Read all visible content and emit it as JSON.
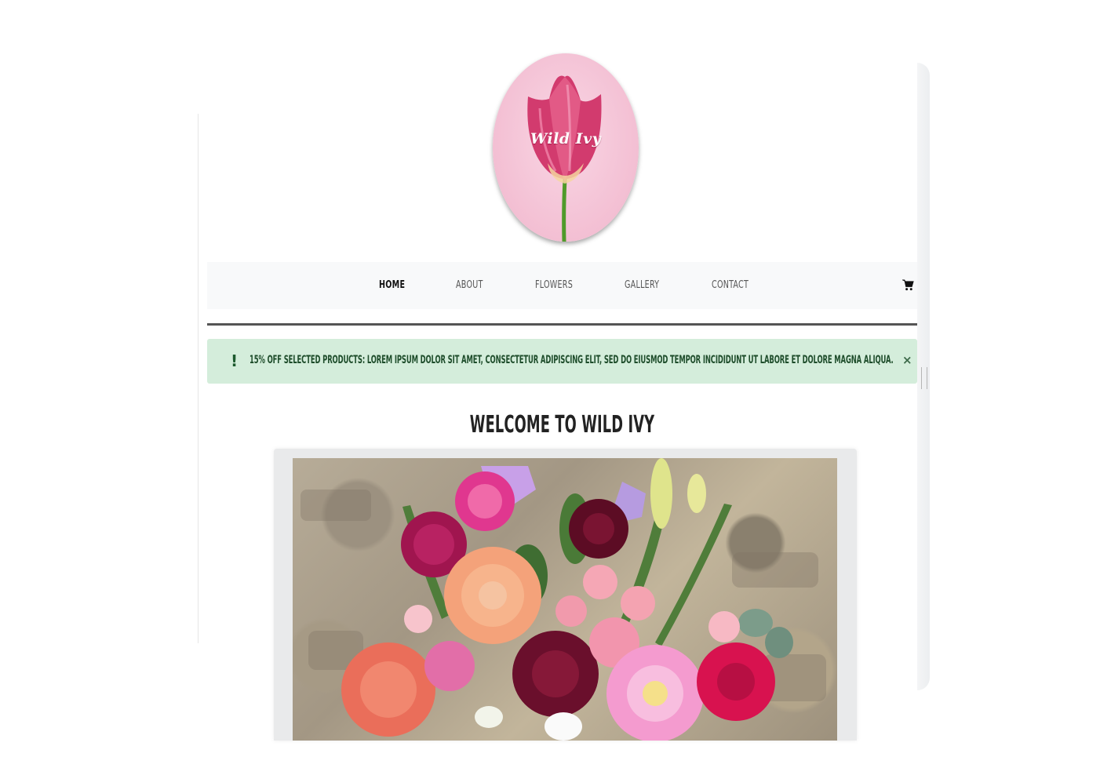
{
  "brand": {
    "logo_text": "Wild Ivy"
  },
  "nav": {
    "items": [
      {
        "label": "HOME",
        "active": true
      },
      {
        "label": "ABOUT",
        "active": false
      },
      {
        "label": "FLOWERS",
        "active": false
      },
      {
        "label": "GALLERY",
        "active": false
      },
      {
        "label": "CONTACT",
        "active": false
      }
    ],
    "cart_icon": "shopping-cart-icon"
  },
  "alert": {
    "icon": "!",
    "text": "15% OFF SELECTED PRODUCTS: LOREM IPSUM DOLOR SIT AMET, CONSECTETUR ADIPISCING ELIT, SED DO EIUSMOD TEMPOR INCIDIDUNT UT LABORE ET DOLORE MAGNA ALIQUA.",
    "close": "×"
  },
  "main": {
    "heading": "WELCOME TO WILD IVY"
  },
  "colors": {
    "alert_bg": "#d4eddb",
    "alert_text": "#1e4d2b",
    "nav_bg": "#f8f9fa",
    "logo_pink": "#f3bfd3"
  }
}
